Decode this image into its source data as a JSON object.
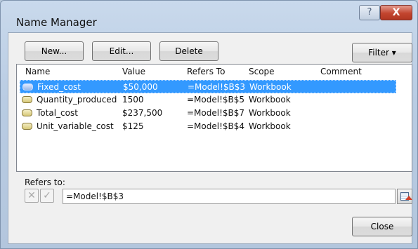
{
  "window": {
    "title": "Name Manager",
    "help_glyph": "?",
    "close_glyph": "X"
  },
  "toolbar": {
    "new_label": "New...",
    "edit_label": "Edit...",
    "delete_label": "Delete",
    "filter_label": "Filter ▾"
  },
  "list": {
    "columns": [
      "Name",
      "Value",
      "Refers To",
      "Scope",
      "Comment"
    ],
    "rows": [
      {
        "name": "Fixed_cost",
        "value": "$50,000",
        "refers_to": "=Model!$B$3",
        "scope": "Workbook",
        "comment": "",
        "selected": true
      },
      {
        "name": "Quantity_produced",
        "value": "1500",
        "refers_to": "=Model!$B$5",
        "scope": "Workbook",
        "comment": "",
        "selected": false
      },
      {
        "name": "Total_cost",
        "value": "$237,500",
        "refers_to": "=Model!$B$7",
        "scope": "Workbook",
        "comment": "",
        "selected": false
      },
      {
        "name": "Unit_variable_cost",
        "value": "$125",
        "refers_to": "=Model!$B$4",
        "scope": "Workbook",
        "comment": "",
        "selected": false
      }
    ]
  },
  "refers": {
    "label": "Refers to:",
    "value": "=Model!$B$3",
    "cancel_glyph": "✕",
    "ok_glyph": "✓"
  },
  "footer": {
    "close_label": "Close"
  },
  "colors": {
    "selection": "#3399ff",
    "close_button": "#c2452f"
  },
  "icons": {
    "name_item": "name-tag-icon",
    "range_picker": "collapse-dialog-icon"
  }
}
